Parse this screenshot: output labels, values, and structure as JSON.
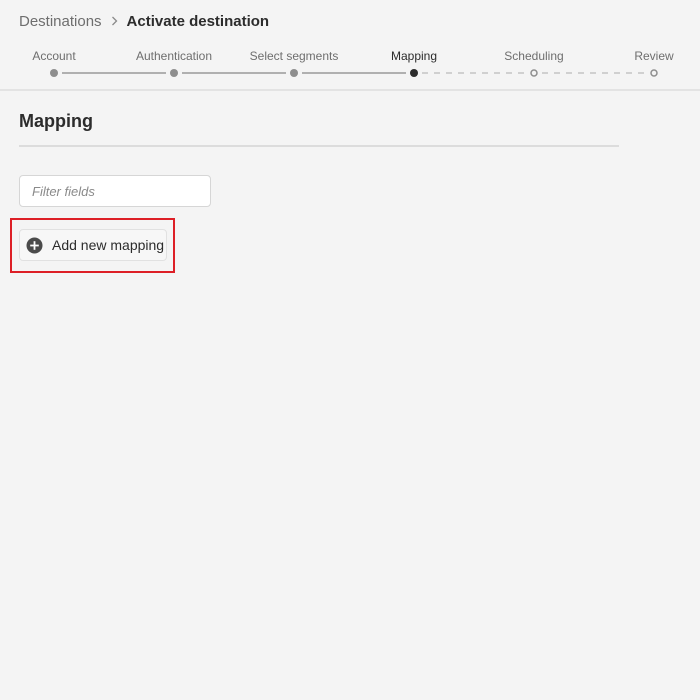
{
  "breadcrumb": {
    "parent": "Destinations",
    "current": "Activate destination"
  },
  "stepper": {
    "steps": [
      {
        "label": "Account",
        "state": "complete"
      },
      {
        "label": "Authentication",
        "state": "complete"
      },
      {
        "label": "Select segments",
        "state": "complete"
      },
      {
        "label": "Mapping",
        "state": "current"
      },
      {
        "label": "Scheduling",
        "state": "upcoming"
      },
      {
        "label": "Review",
        "state": "upcoming"
      }
    ]
  },
  "section": {
    "title": "Mapping"
  },
  "filter": {
    "placeholder": "Filter fields",
    "value": ""
  },
  "add_mapping": {
    "label": "Add new mapping",
    "icon": "add-circle-icon"
  },
  "colors": {
    "background": "#f4f4f4",
    "complete_dot": "#8e8e8e",
    "current_dot": "#2c2c2c",
    "highlight": "#dd1f26"
  }
}
